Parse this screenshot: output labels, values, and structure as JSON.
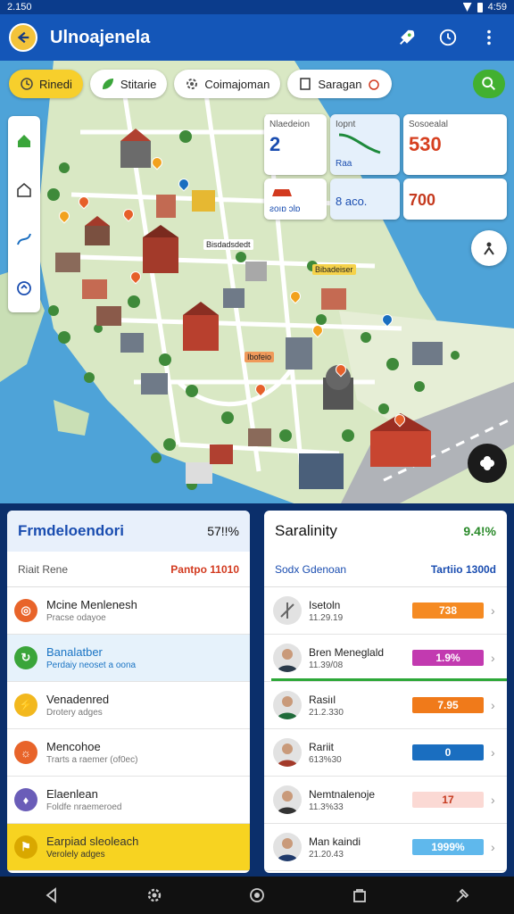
{
  "status": {
    "time": "2.150",
    "right_text": "4:59"
  },
  "app": {
    "title": "Ulnoajenela"
  },
  "chips": [
    {
      "label": "Rinedi",
      "active": true,
      "icon": "clock-icon"
    },
    {
      "label": "Stitarie",
      "active": false,
      "icon": "leaf-icon"
    },
    {
      "label": "Coimajoman",
      "active": false,
      "icon": "gear-icon"
    },
    {
      "label": "Saragan",
      "active": false,
      "icon": "book-icon"
    }
  ],
  "stats": {
    "card1": {
      "label": "Nlaedeion",
      "value": "2",
      "foot": "ƨoıɒ ɔlɒ"
    },
    "card2": {
      "label": "Iopnt",
      "value": "Raa",
      "foot": "8 aco."
    },
    "card3": {
      "label": "Sosoealal",
      "value": "530",
      "foot": "700"
    }
  },
  "map_labels": [
    "Bisdadsdedt",
    "Bibadeiser",
    "Ibofeio"
  ],
  "left_panel": {
    "title": "Frmdeloendori",
    "percent": "57!!%",
    "sub_left": "Riait Rene",
    "sub_right": "Pantpo 11010",
    "rows": [
      {
        "name": "Mcine Menlenesh",
        "sub": "Pracse odayoe",
        "color": "#e8642a",
        "icon": "scan-icon"
      },
      {
        "name": "Banalatber",
        "sub": "Perdaiy neoset a oona",
        "color": "#3aa53a",
        "icon": "refresh-icon"
      },
      {
        "name": "Venadenred",
        "sub": "Drotery adges",
        "color": "#f2b81e",
        "icon": "lightning-icon"
      },
      {
        "name": "Mencohoe",
        "sub": "Trarts a raemer (of0ec)",
        "color": "#e8642a",
        "icon": "sun-icon"
      },
      {
        "name": "Elaenlean",
        "sub": "Foldfe nraemeroed",
        "color": "#6a5db8",
        "icon": "shield-icon"
      },
      {
        "name": "Earpiad sleoleach",
        "sub": "Verolely adges",
        "color": "#f7d321",
        "icon": "flag-icon"
      }
    ]
  },
  "right_panel": {
    "title": "Saralinity",
    "percent": "9.4!%",
    "sub_left": "Sodx Gdenoan",
    "sub_right": "Tartiio 1300d",
    "rows": [
      {
        "name": "Isetoln",
        "sub": "11.29.19",
        "value": "738",
        "color": "#f58a22",
        "fill": 1.0
      },
      {
        "name": "Bren Meneglald",
        "sub": "11.39/08",
        "value": "1.9%",
        "color": "#c23ab0",
        "fill": 1.0
      },
      {
        "name": "Rasiıl",
        "sub": "21.2.330",
        "value": "7.95",
        "color": "#f07a1a",
        "fill": 1.0
      },
      {
        "name": "Rariit",
        "sub": "613%30",
        "value": "0",
        "color": "#1a6ec0",
        "fill": 1.0
      },
      {
        "name": "Nemtnalenoje",
        "sub": "11.3%33",
        "value": "17",
        "color": "#fbd9d4",
        "fill": 1.0
      },
      {
        "name": "Man kaindi",
        "sub": "21.20.43",
        "value": "1999%",
        "color": "#5fb8ec",
        "fill": 1.0
      }
    ]
  }
}
